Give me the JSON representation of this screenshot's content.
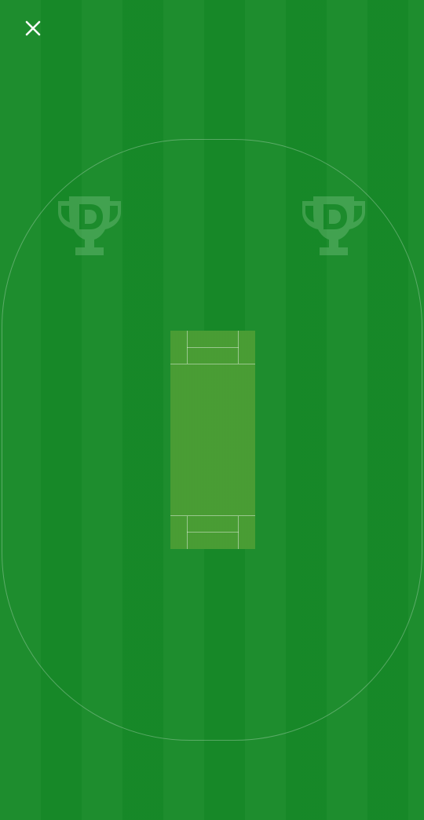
{
  "header": {
    "close_icon": "close-icon"
  },
  "field": {
    "logos": [
      "trophy-d-logo",
      "trophy-d-logo"
    ],
    "colors": {
      "stripe_light": "#1e8f2f",
      "stripe_dark": "#178a29",
      "pitch": "#4a9f34",
      "boundary_line": "rgba(255,255,255,0.28)"
    }
  }
}
